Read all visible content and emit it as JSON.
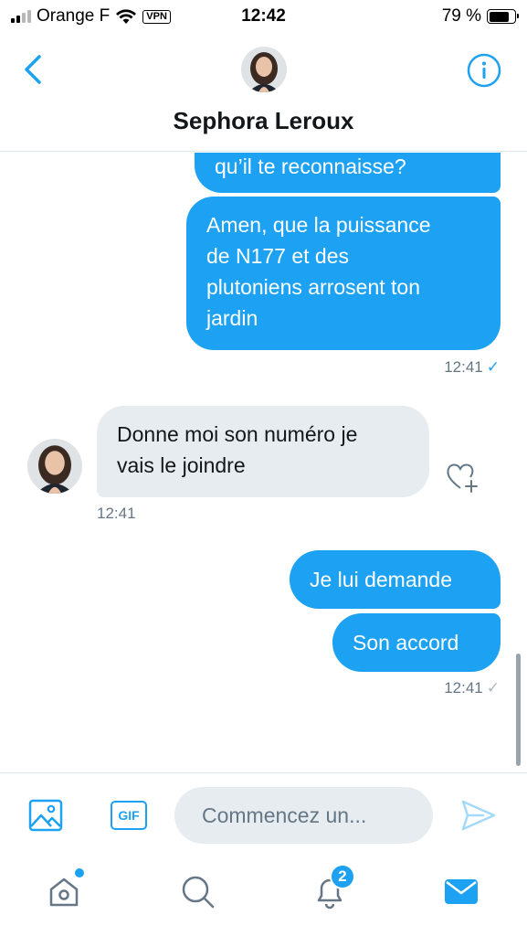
{
  "status_bar": {
    "carrier": "Orange F",
    "vpn": "VPN",
    "time": "12:42",
    "battery_percent_label": "79 %",
    "battery_level": 0.79
  },
  "header": {
    "contact_name": "Sephora Leroux"
  },
  "messages": [
    {
      "direction": "out",
      "text": "qu’il te reconnaisse?"
    },
    {
      "direction": "out",
      "lines": [
        "Amen, que la puissance",
        "de N177 et des",
        "plutoniens arrosent ton",
        "jardin"
      ],
      "time": "12:41",
      "read": true
    },
    {
      "direction": "in",
      "lines": [
        "Donne moi son numéro je",
        "vais le joindre"
      ],
      "time": "12:41"
    },
    {
      "direction": "out",
      "text": "Je lui demande"
    },
    {
      "direction": "out",
      "text": "Son accord",
      "time": "12:41",
      "read": false
    }
  ],
  "composer": {
    "gif_label": "GIF",
    "placeholder": "Commencez un..."
  },
  "tabbar": {
    "notifications_count": "2"
  },
  "colors": {
    "accent": "#1da1f2",
    "incoming_bubble": "#e6ecf0",
    "meta_text": "#657786"
  }
}
